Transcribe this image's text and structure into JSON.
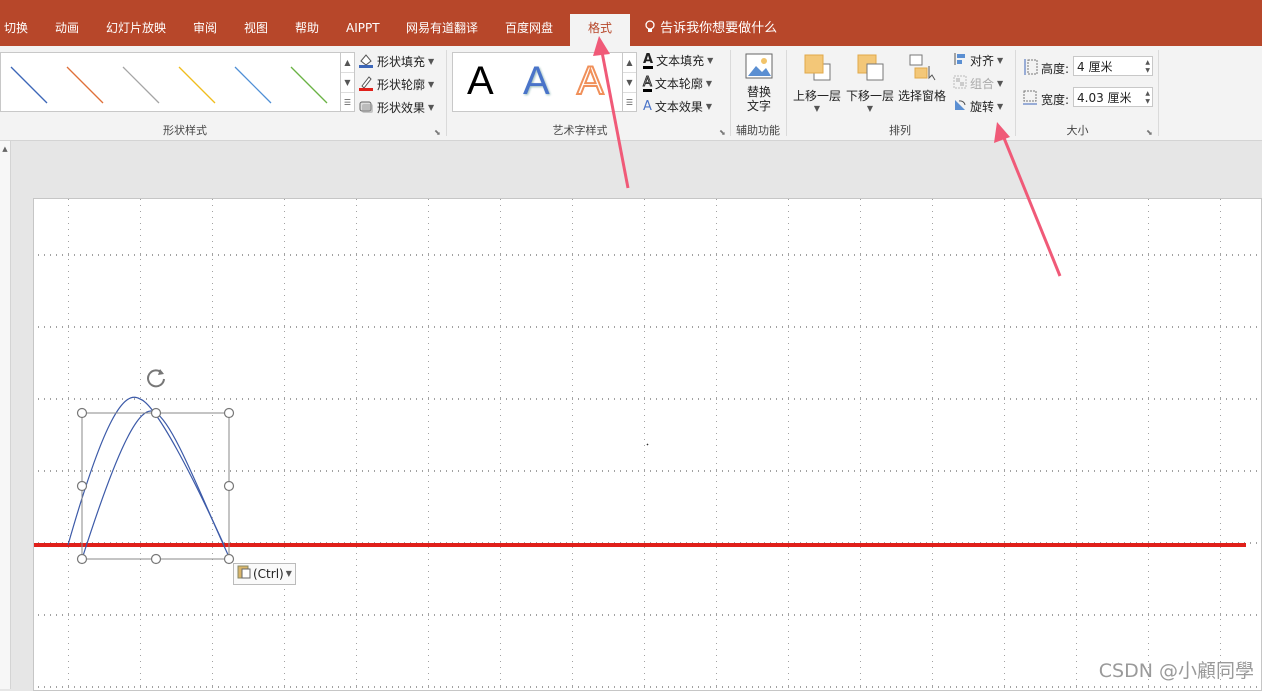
{
  "ribbon_tabs": {
    "t0": "切换",
    "t1": "动画",
    "t2": "幻灯片放映",
    "t3": "审阅",
    "t4": "视图",
    "t5": "帮助",
    "t6": "AIPPT",
    "t7": "网易有道翻译",
    "t8": "百度网盘",
    "t9": "格式"
  },
  "tell_me": "告诉我你想要做什么",
  "shape_styles": {
    "group_label": "形状样式",
    "fill": "形状填充",
    "outline": "形状轮廓",
    "effects": "形状效果",
    "line_colors": [
      "#3c66b8",
      "#e0703a",
      "#a5a5a5",
      "#f0be1e",
      "#4f8fd6",
      "#6ab344"
    ]
  },
  "wordart": {
    "group_label": "艺术字样式",
    "samples": [
      "A",
      "A",
      "A"
    ],
    "text_fill": "文本填充",
    "text_outline": "文本轮廓",
    "text_effects": "文本效果"
  },
  "accessibility": {
    "alt_text": "替换文字",
    "group_label": "辅助功能"
  },
  "arrange": {
    "bring_forward": "上移一层",
    "send_backward": "下移一层",
    "selection_pane": "选择窗格",
    "align": "对齐",
    "group": "组合",
    "rotate": "旋转",
    "group_label": "排列"
  },
  "size": {
    "height_label": "高度:",
    "height_value": "4 厘米",
    "width_label": "宽度:",
    "width_value": "4.03 厘米",
    "group_label": "大小"
  },
  "paste_options": "(Ctrl)",
  "watermark": "CSDN @小顧同學",
  "colors": {
    "tab_bar": "#b7472a",
    "red_line": "#e0201a",
    "arrow": "#f05a78",
    "curve": "#3c5aa8"
  }
}
